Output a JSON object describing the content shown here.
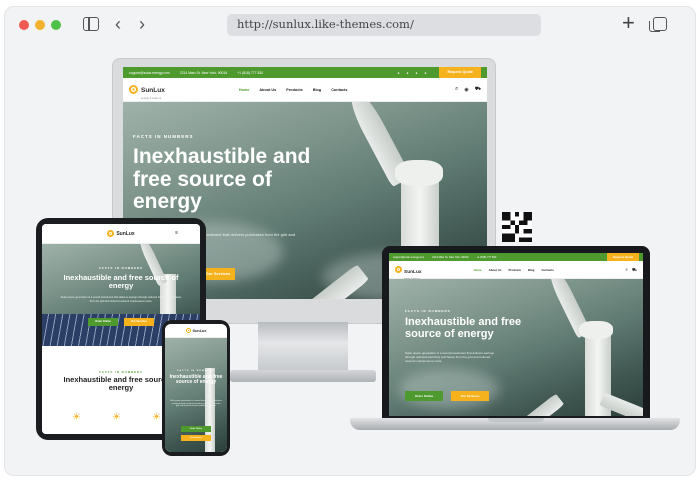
{
  "browser": {
    "url": "http://sunlux.like-themes.com/"
  },
  "site": {
    "brand": "SunLux",
    "tagline": "energy & solar co",
    "topbar": {
      "email": "support@solar-energy.com",
      "address": "2214 Main St. New York, 90016",
      "phone": "+1 (818) 777 830"
    },
    "quote_label": "Request Quote",
    "menu": [
      "Home",
      "About Us",
      "Products",
      "Blog",
      "Contacts"
    ],
    "hero": {
      "eyebrow": "FACTS IN NUMBERS",
      "headline": "Inexhaustible and free source of energy",
      "lead": "Solar power generation is a sound investment that delivers savings through reduced electricity purchases from the grid and reduced network maintenance costs.",
      "lead_short": "nvestment that delivers purchases from the grid and",
      "btn_primary": "Order Online",
      "btn_secondary": "Our Services"
    }
  },
  "colors": {
    "accent_green": "#4e9a2e",
    "accent_yellow": "#f5b21c"
  },
  "icons": [
    "sidebar-toggle-icon",
    "chevron-left-icon",
    "chevron-right-icon",
    "plus-icon",
    "tabs-icon",
    "search-icon",
    "cart-icon",
    "qr-code-icon"
  ]
}
